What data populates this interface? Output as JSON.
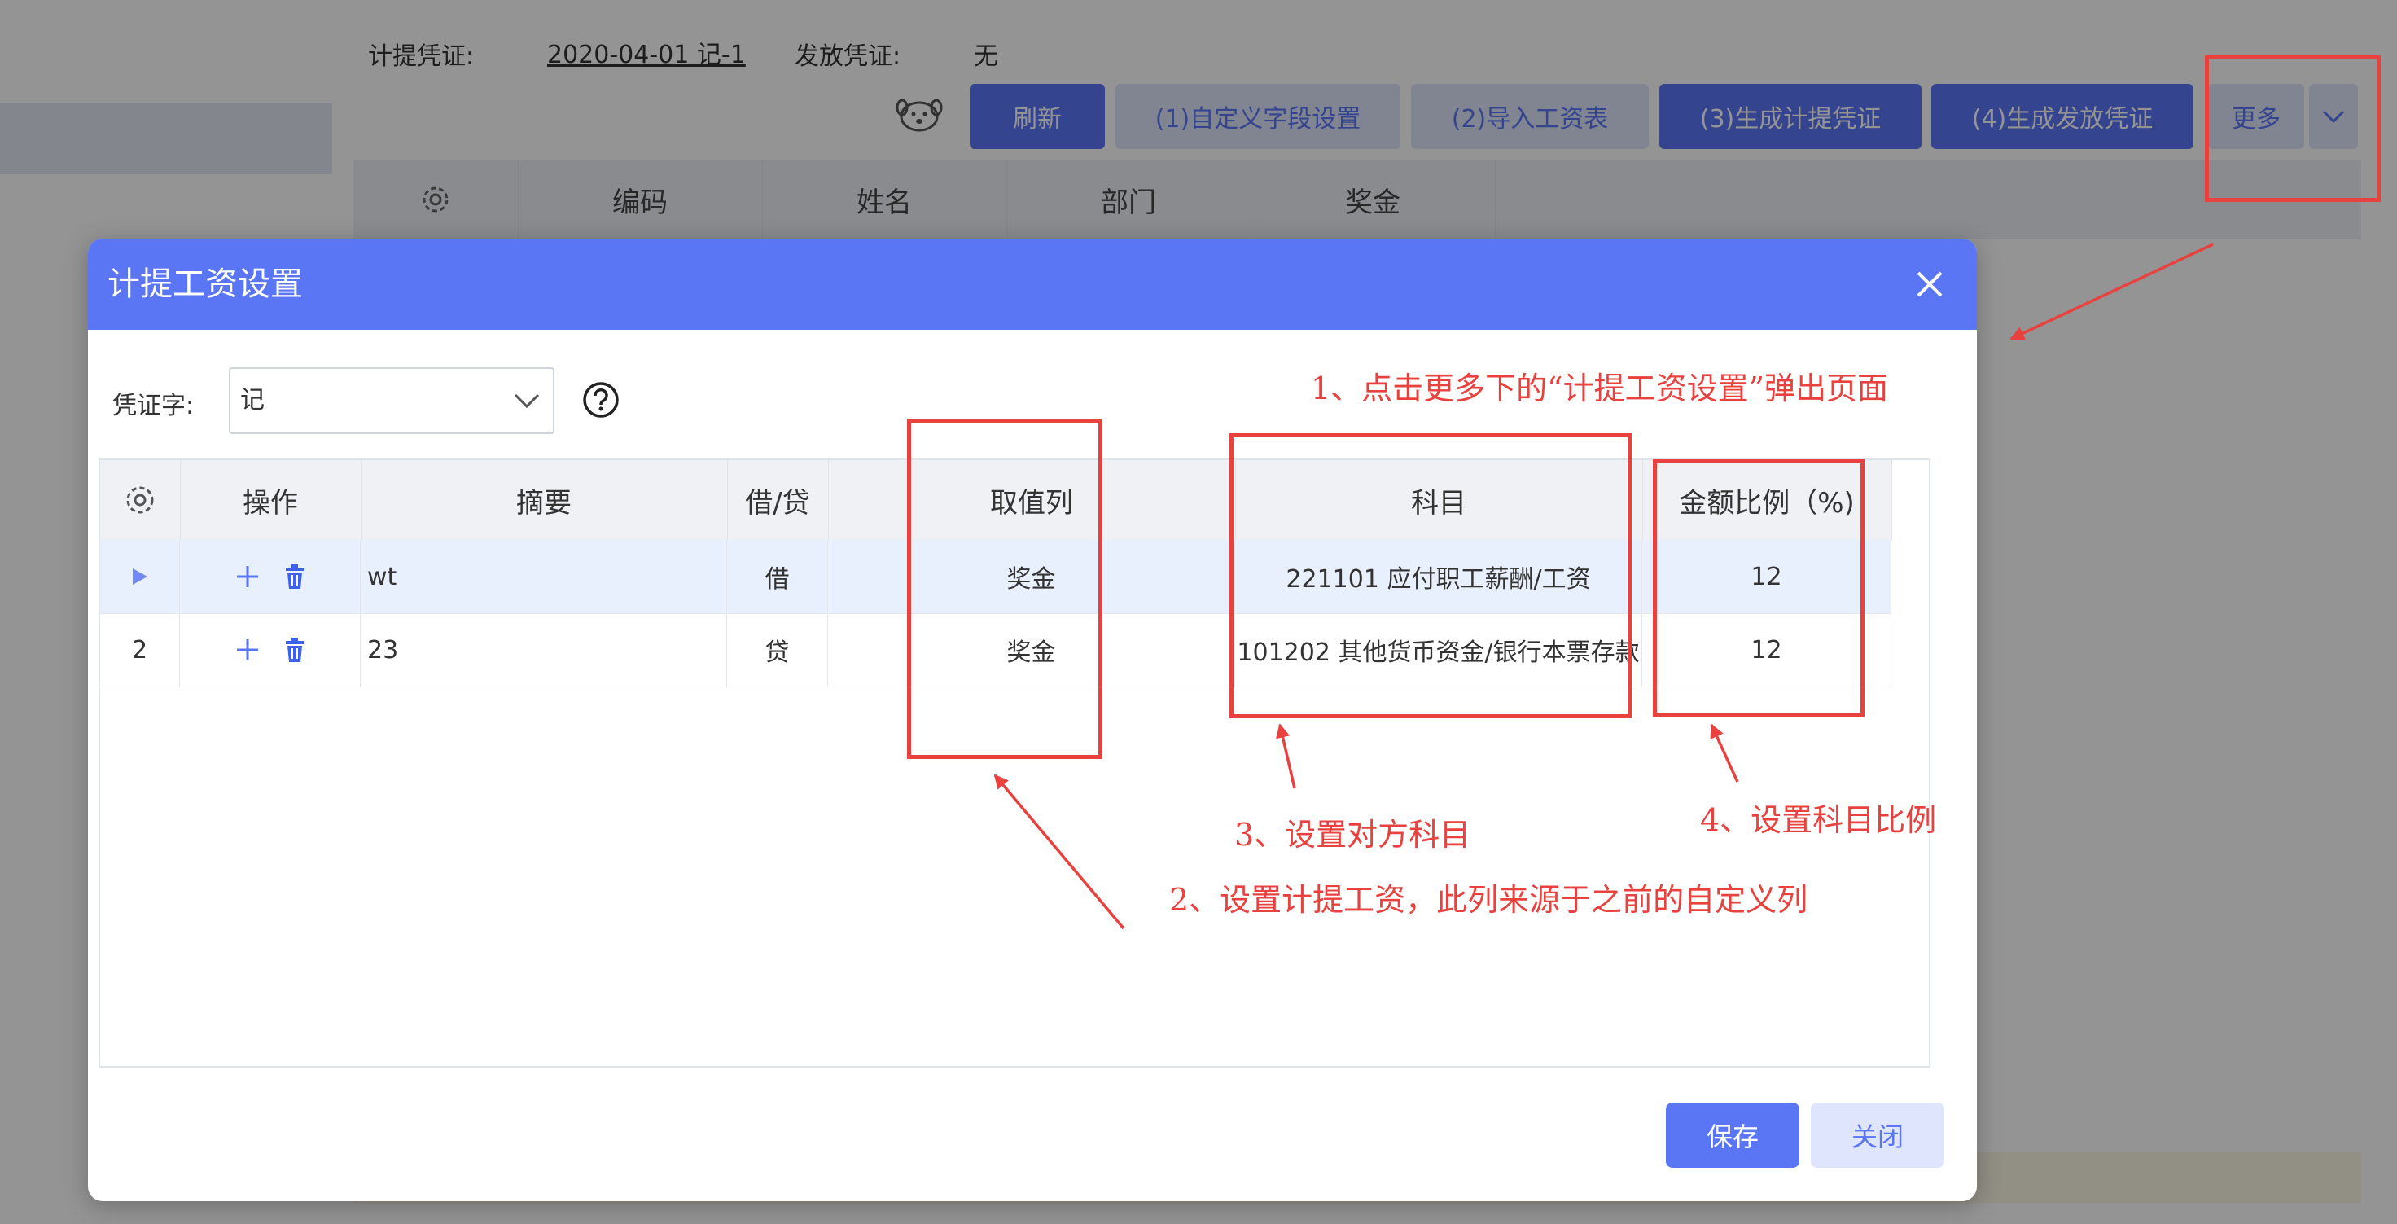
{
  "background": {
    "accrual_label": "计提凭证:",
    "accrual_value": "2020-04-01 记-1",
    "payout_label": "发放凭证:",
    "payout_value": "无",
    "toolbar": {
      "refresh": "刷新",
      "custom_fields": "(1)自定义字段设置",
      "import_salary": "(2)导入工资表",
      "gen_accrual": "(3)生成计提凭证",
      "gen_payout": "(4)生成发放凭证",
      "more": "更多"
    },
    "table_headers": [
      "编码",
      "姓名",
      "部门",
      "奖金"
    ]
  },
  "modal": {
    "title": "计提工资设置",
    "voucher_label": "凭证字:",
    "voucher_value": "记",
    "columns": {
      "ops": "操作",
      "summary": "摘要",
      "dc": "借/贷",
      "value_col": "取值列",
      "account": "科目",
      "ratio": "金额比例（%)"
    },
    "rows": [
      {
        "index": "",
        "summary": "wt",
        "dc": "借",
        "value_col": "奖金",
        "account": "221101 应付职工薪酬/工资",
        "ratio": "12",
        "selected": true
      },
      {
        "index": "2",
        "summary": "23",
        "dc": "贷",
        "value_col": "奖金",
        "account": "101202 其他货币资金/银行本票存款",
        "ratio": "12",
        "selected": false
      }
    ],
    "save": "保存",
    "close": "关闭"
  },
  "annotations": {
    "note1": "1、点击更多下的“计提工资设置”弹出页面",
    "note2": "2、设置计提工资，此列来源于之前的自定义列",
    "note3": "3、设置对方科目",
    "note4": "4、设置科目比例"
  },
  "colors": {
    "primary": "#5b76f5",
    "light_button": "#dfe5fc",
    "annotation_red": "#e8413e"
  }
}
